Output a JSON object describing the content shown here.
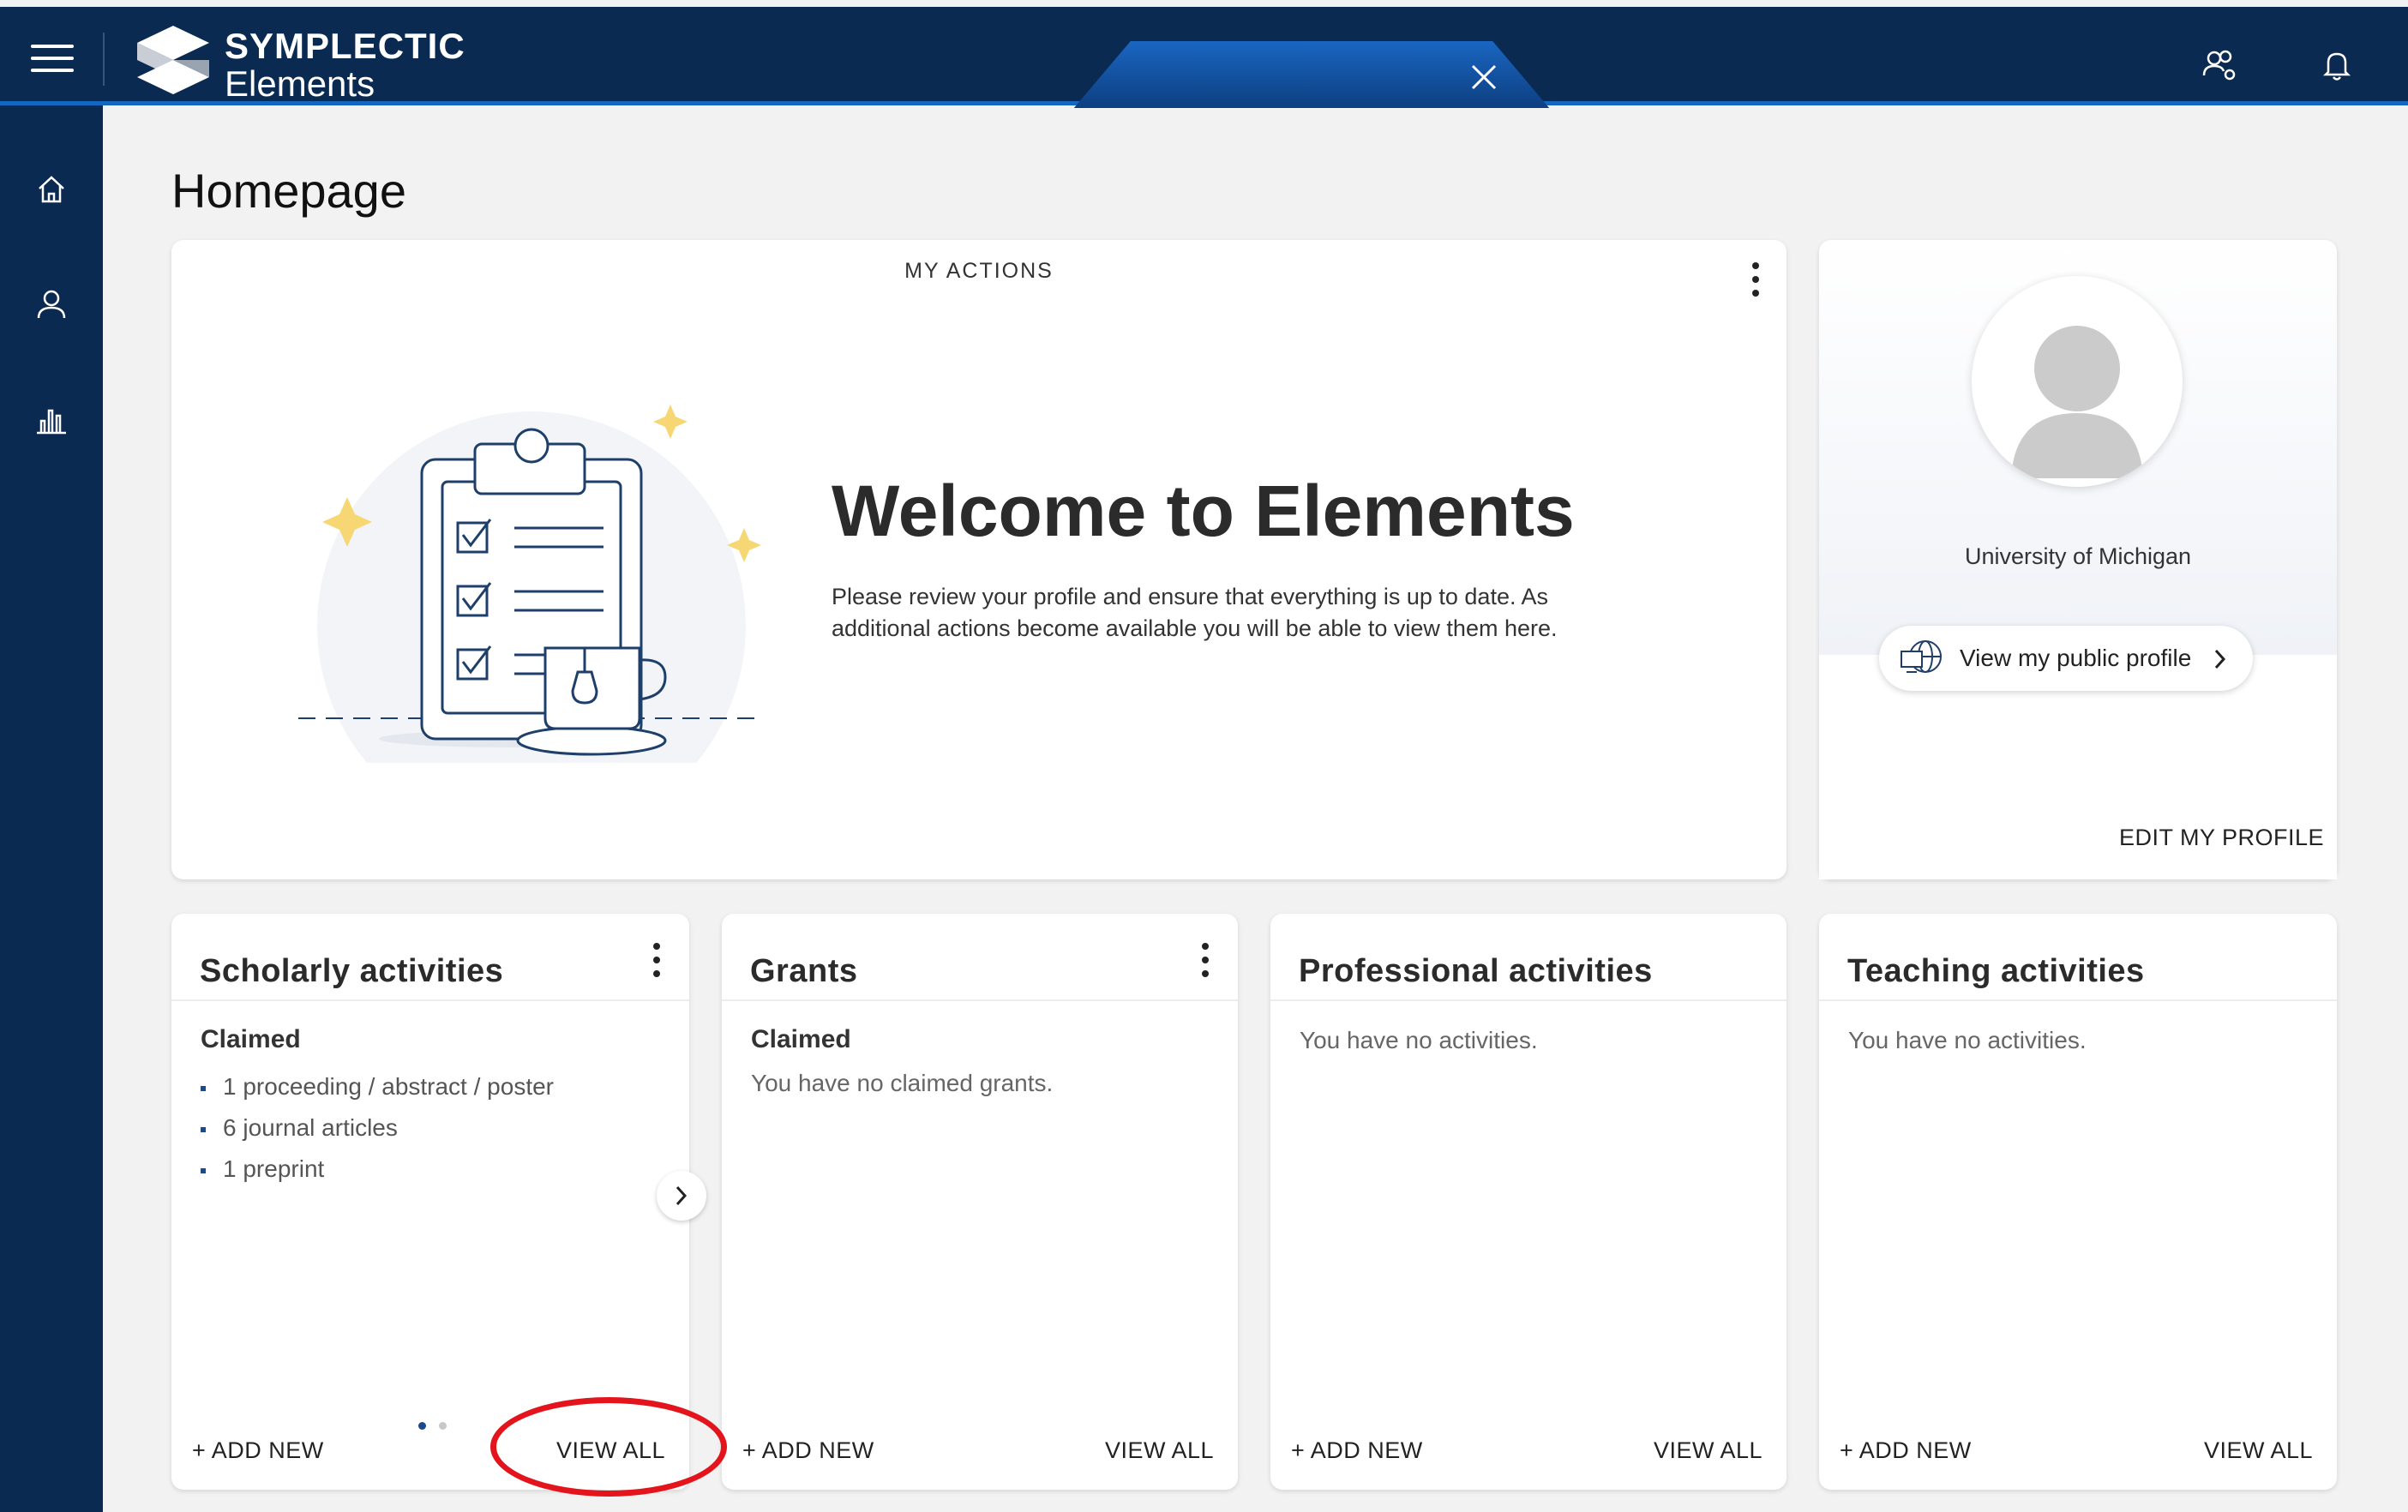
{
  "header": {
    "brand_line1": "SYMPLECTIC",
    "brand_line2": "Elements",
    "menu_icon": "hamburger-menu-icon",
    "close_icon": "close-icon",
    "right_icons": [
      "users-settings-icon",
      "bell-icon"
    ]
  },
  "sidebar": {
    "items": [
      {
        "icon": "home-icon"
      },
      {
        "icon": "person-icon"
      },
      {
        "icon": "bar-chart-icon"
      }
    ]
  },
  "page": {
    "title": "Homepage"
  },
  "my_actions": {
    "label": "MY ACTIONS",
    "welcome_title": "Welcome to Elements",
    "welcome_text": "Please review your profile and ensure that everything is up to date. As additional actions become available you will be able to view them here."
  },
  "profile": {
    "institution": "University of Michigan",
    "public_profile_label": "View my public profile",
    "edit_label": "EDIT MY PROFILE"
  },
  "activity_cards": [
    {
      "title": "Scholarly activities",
      "subheading": "Claimed",
      "items": [
        "1 proceeding / abstract / poster",
        "6 journal articles",
        "1 preprint"
      ],
      "add_label": "+ ADD NEW",
      "view_label": "VIEW ALL"
    },
    {
      "title": "Grants",
      "subheading": "Claimed",
      "message": "You have no claimed grants.",
      "add_label": "+ ADD NEW",
      "view_label": "VIEW ALL"
    },
    {
      "title": "Professional activities",
      "message": "You have no activities.",
      "add_label": "+ ADD NEW",
      "view_label": "VIEW ALL"
    },
    {
      "title": "Teaching activities",
      "message": "You have no activities.",
      "add_label": "+ ADD NEW",
      "view_label": "VIEW ALL"
    }
  ],
  "colors": {
    "navy": "#0b2a52",
    "accent_blue": "#1467c0",
    "annotation_red": "#e3141b",
    "sparkle_yellow": "#f7d774"
  }
}
